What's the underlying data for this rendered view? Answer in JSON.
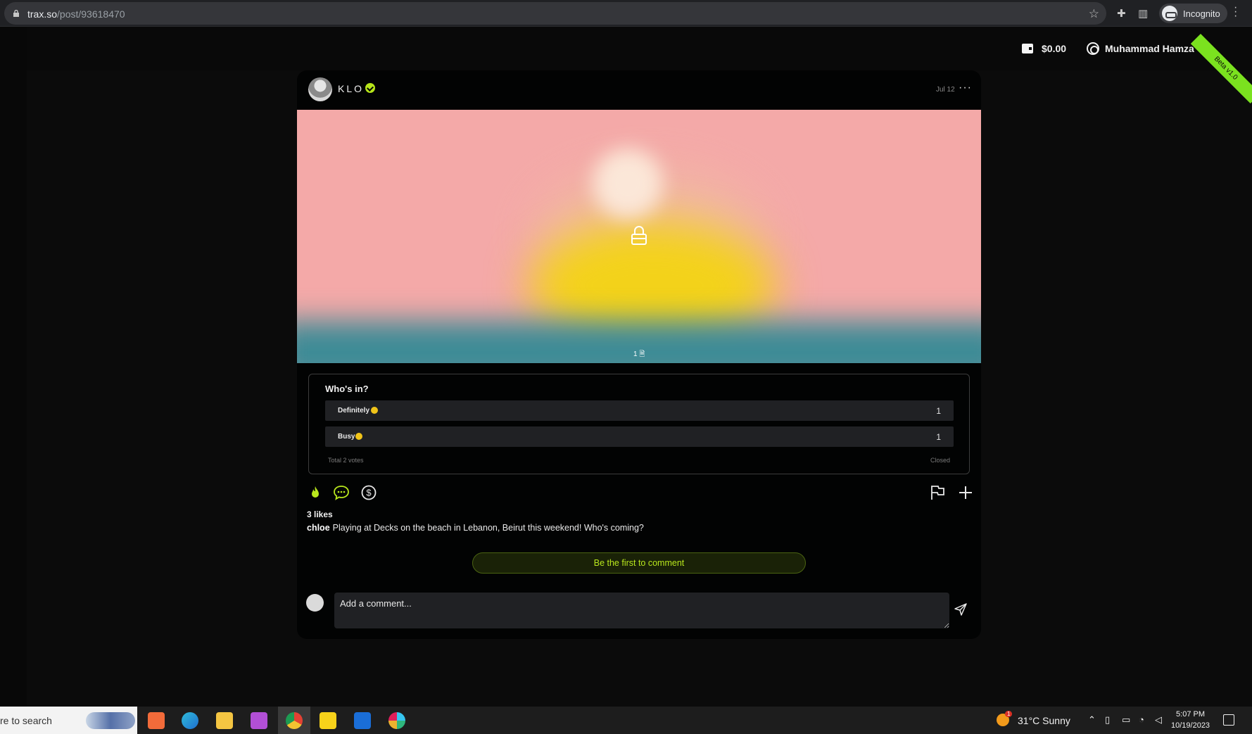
{
  "browser": {
    "url_host": "trax.so",
    "url_path": "/post/93618470",
    "incognito_label": "Incognito"
  },
  "header": {
    "balance": "$0.00",
    "user_name": "Muhammad Hamza",
    "beta_label": "Beta v1.0"
  },
  "post": {
    "author": "KLO",
    "date": "Jul 12",
    "media_count": "1",
    "poll": {
      "question": "Who's in?",
      "options": [
        {
          "label": "Definitely",
          "count": "1"
        },
        {
          "label": "Busy",
          "count": "1"
        }
      ],
      "total": "Total 2 votes",
      "status": "Closed"
    },
    "likes": "3 likes",
    "caption_author": "chloe",
    "caption_text": "Playing at Decks on the beach in Lebanon, Beirut this weekend! Who's coming?",
    "first_comment_label": "Be the first to comment",
    "comment_placeholder": "Add a comment..."
  },
  "taskbar": {
    "search_text": "re to search",
    "weather": "31°C  Sunny",
    "weather_badge": "1",
    "time": "5:07 PM",
    "date": "10/19/2023"
  },
  "colors": {
    "accent": "#b9e81d",
    "beta_ribbon": "#7be21f",
    "card_bg": "#020303"
  }
}
